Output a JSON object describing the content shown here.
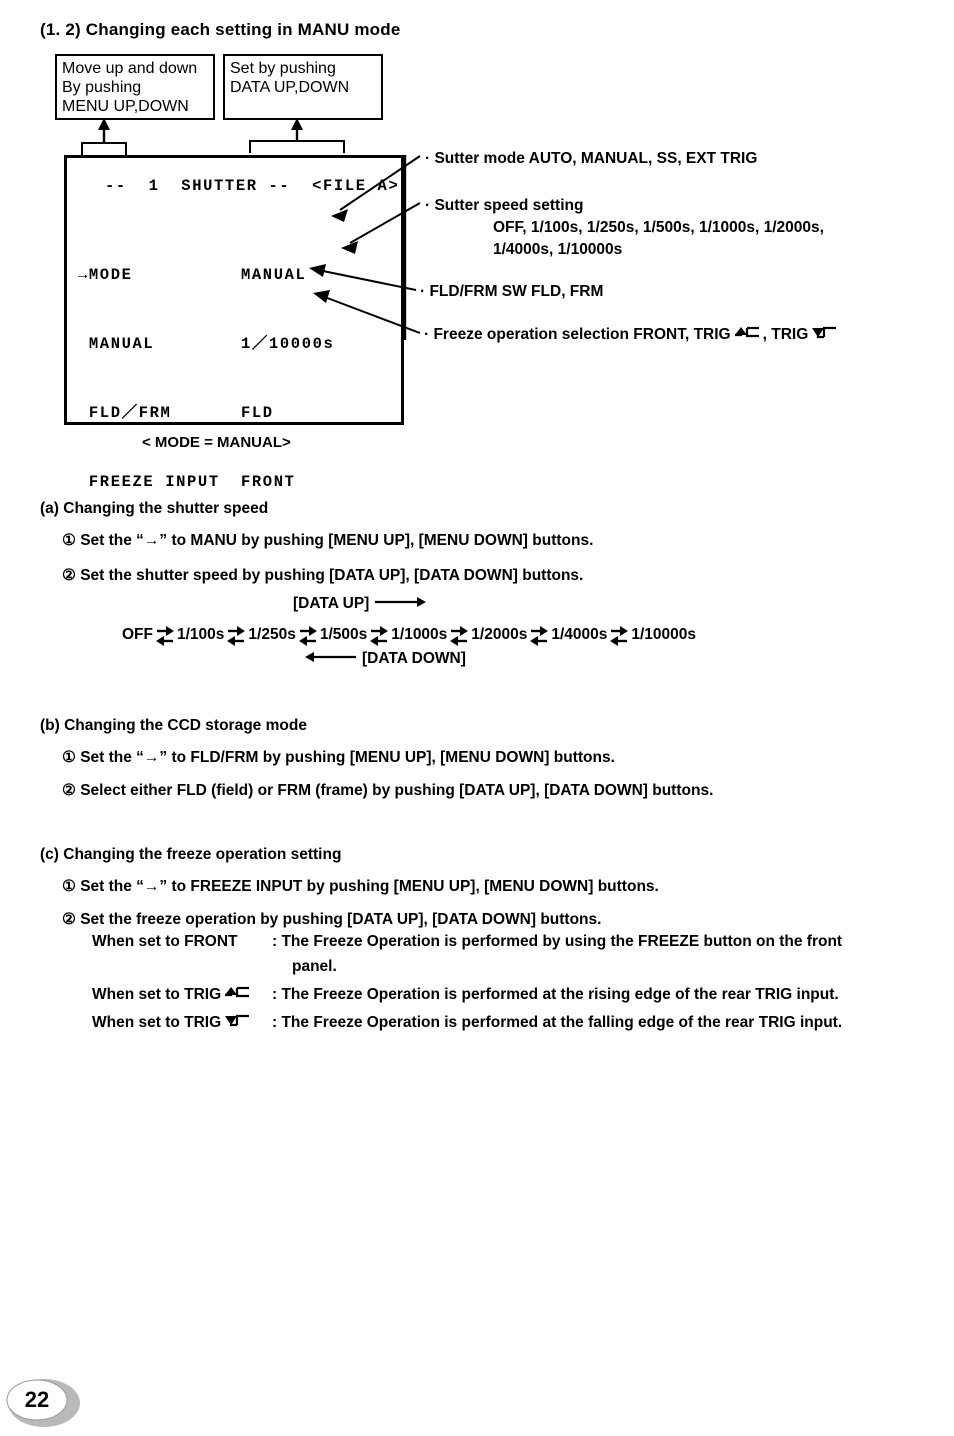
{
  "page": {
    "number": "22",
    "section_heading": "(1. 2)  Changing each setting in MANU mode"
  },
  "callouts": {
    "menu_box": "Move up and down\nBy pushing\nMENU UP,DOWN",
    "data_box": "Set by pushing\nDATA UP,DOWN"
  },
  "osd": {
    "title": "--  1  SHUTTER --  <FILE A>",
    "caption": "< MODE = MANUAL>",
    "rows": [
      {
        "cursor": "→",
        "name": "MODE",
        "value": "MANUAL"
      },
      {
        "cursor": " ",
        "name": "MANUAL",
        "value": "1／10000s"
      },
      {
        "cursor": " ",
        "name": "FLD／FRM",
        "value": "FLD"
      },
      {
        "cursor": " ",
        "name": "FREEZE INPUT",
        "value": "FRONT"
      }
    ]
  },
  "annotations": {
    "shutter_mode": "· Sutter mode    AUTO, MANUAL, SS, EXT TRIG",
    "shutter_speed": "· Sutter speed setting",
    "shutter_speed_values_line1": "OFF, 1/100s, 1/250s, 1/500s, 1/1000s, 1/2000s,",
    "shutter_speed_values_line2": "1/4000s, 1/10000s",
    "fld_frm_sw": "· FLD/FRM SW   FLD, FRM",
    "freeze_prefix": "· Freeze operation selection    FRONT, TRIG",
    "freeze_middle": ", TRIG"
  },
  "sections": {
    "a": {
      "heading": "(a) Changing the shutter speed",
      "step1": "① Set the “→” to MANU by pushing [MENU UP], [MENU DOWN] buttons.",
      "step2": "② Set the shutter speed by pushing [DATA UP], [DATA DOWN] buttons.",
      "data_up_label": "[DATA UP]",
      "data_down_label": "[DATA DOWN]",
      "speed_chain": [
        "OFF",
        "1/100s",
        "1/250s",
        "1/500s",
        "1/1000s",
        "1/2000s",
        "1/4000s",
        "1/10000s"
      ]
    },
    "b": {
      "heading": "(b) Changing the CCD storage mode",
      "step1": "① Set the “→” to FLD/FRM by pushing [MENU UP], [MENU DOWN] buttons.",
      "step2": "② Select either FLD (field) or FRM (frame) by pushing [DATA UP], [DATA DOWN] buttons."
    },
    "c": {
      "heading": "(c) Changing the freeze operation setting",
      "step1": "① Set the “→” to FREEZE INPUT by pushing [MENU UP], [MENU DOWN] buttons.",
      "step2": "② Set the freeze operation by pushing [DATA UP], [DATA DOWN] buttons.",
      "when_front_label": "When set to FRONT",
      "when_front_text": ": The Freeze Operation is performed by using the FREEZE button on the front",
      "when_front_cont": "panel.",
      "when_rise_label": "When set to TRIG",
      "when_rise_text": ": The Freeze Operation is performed at the rising edge of the rear TRIG input.",
      "when_fall_label": "When set to TRIG",
      "when_fall_text": ": The Freeze Operation is performed at the falling edge of the rear TRIG input."
    }
  },
  "colors": {
    "ink": "#000000",
    "paper": "#ffffff",
    "badge_gray": "#b9b9b9"
  }
}
